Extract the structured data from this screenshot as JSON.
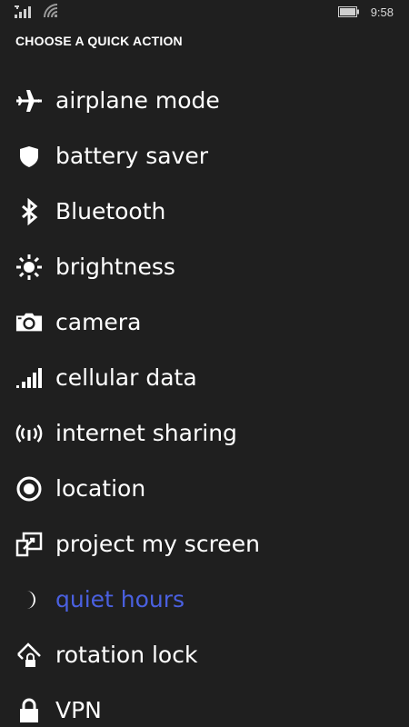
{
  "status_bar": {
    "time": "9:58",
    "icons": [
      "cellular-signal-icon",
      "wifi-icon",
      "battery-icon"
    ]
  },
  "title": "CHOOSE A QUICK ACTION",
  "accent_color": "#4a60e0",
  "actions": [
    {
      "label": "airplane mode",
      "icon": "airplane-icon"
    },
    {
      "label": "battery saver",
      "icon": "shield-icon"
    },
    {
      "label": "Bluetooth",
      "icon": "bluetooth-icon"
    },
    {
      "label": "brightness",
      "icon": "brightness-icon"
    },
    {
      "label": "camera",
      "icon": "camera-icon"
    },
    {
      "label": "cellular data",
      "icon": "signal-bars-icon"
    },
    {
      "label": "internet sharing",
      "icon": "broadcast-icon"
    },
    {
      "label": "location",
      "icon": "location-icon"
    },
    {
      "label": "project my screen",
      "icon": "project-screen-icon"
    },
    {
      "label": "quiet hours",
      "icon": "moon-icon",
      "selected": true
    },
    {
      "label": "rotation lock",
      "icon": "rotation-lock-icon"
    },
    {
      "label": "VPN",
      "icon": "lock-icon"
    }
  ]
}
